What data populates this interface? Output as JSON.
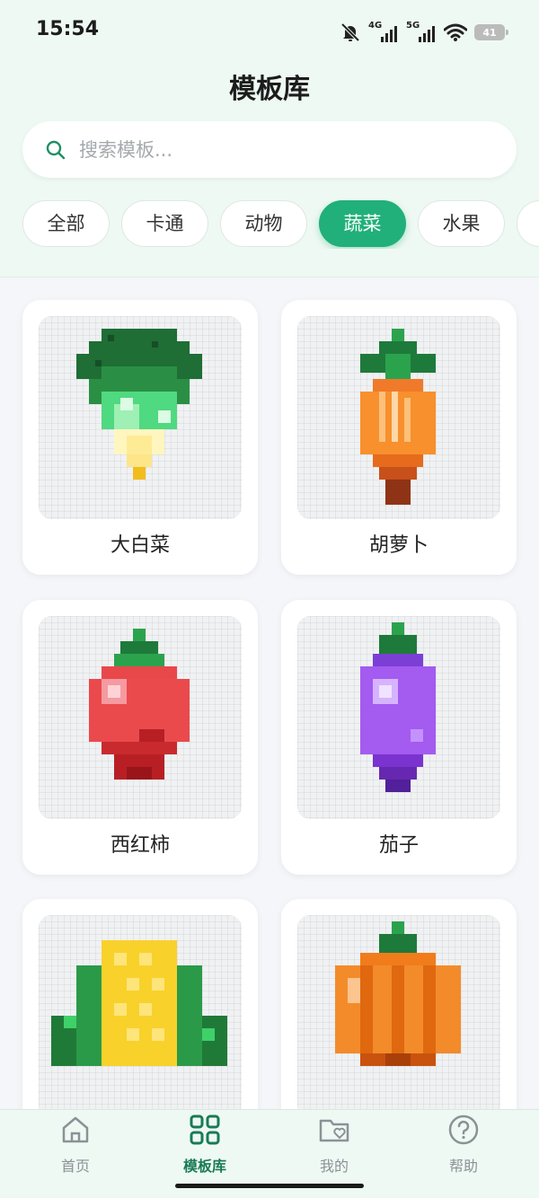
{
  "status_bar": {
    "time": "15:54",
    "sim1_label": "4G",
    "sim2_label": "5G",
    "battery": "41",
    "icons": [
      "mute-bell-icon",
      "signal-icon",
      "signal-icon",
      "wifi-icon",
      "battery-icon"
    ]
  },
  "header": {
    "title": "模板库"
  },
  "search": {
    "placeholder": "搜索模板..."
  },
  "categories": [
    {
      "label": "全部",
      "active": false
    },
    {
      "label": "卡通",
      "active": false
    },
    {
      "label": "动物",
      "active": false
    },
    {
      "label": "蔬菜",
      "active": true
    },
    {
      "label": "水果",
      "active": false
    },
    {
      "label": "",
      "active": false
    }
  ],
  "templates": [
    {
      "name": "大白菜",
      "icon": "cabbage-pixel-art"
    },
    {
      "name": "胡萝卜",
      "icon": "carrot-pixel-art"
    },
    {
      "name": "西红柿",
      "icon": "tomato-pixel-art"
    },
    {
      "name": "茄子",
      "icon": "eggplant-pixel-art"
    },
    {
      "name": "",
      "icon": "corn-pixel-art"
    },
    {
      "name": "",
      "icon": "pumpkin-pixel-art"
    }
  ],
  "bottom_nav": [
    {
      "label": "首页",
      "icon": "home-icon",
      "active": false
    },
    {
      "label": "模板库",
      "icon": "grid-icon",
      "active": true
    },
    {
      "label": "我的",
      "icon": "folder-heart-icon",
      "active": false
    },
    {
      "label": "帮助",
      "icon": "help-icon",
      "active": false
    }
  ],
  "colors": {
    "accent": "#21b07a",
    "header_bg": "#eef9f3",
    "page_bg": "#f4f6f9"
  }
}
